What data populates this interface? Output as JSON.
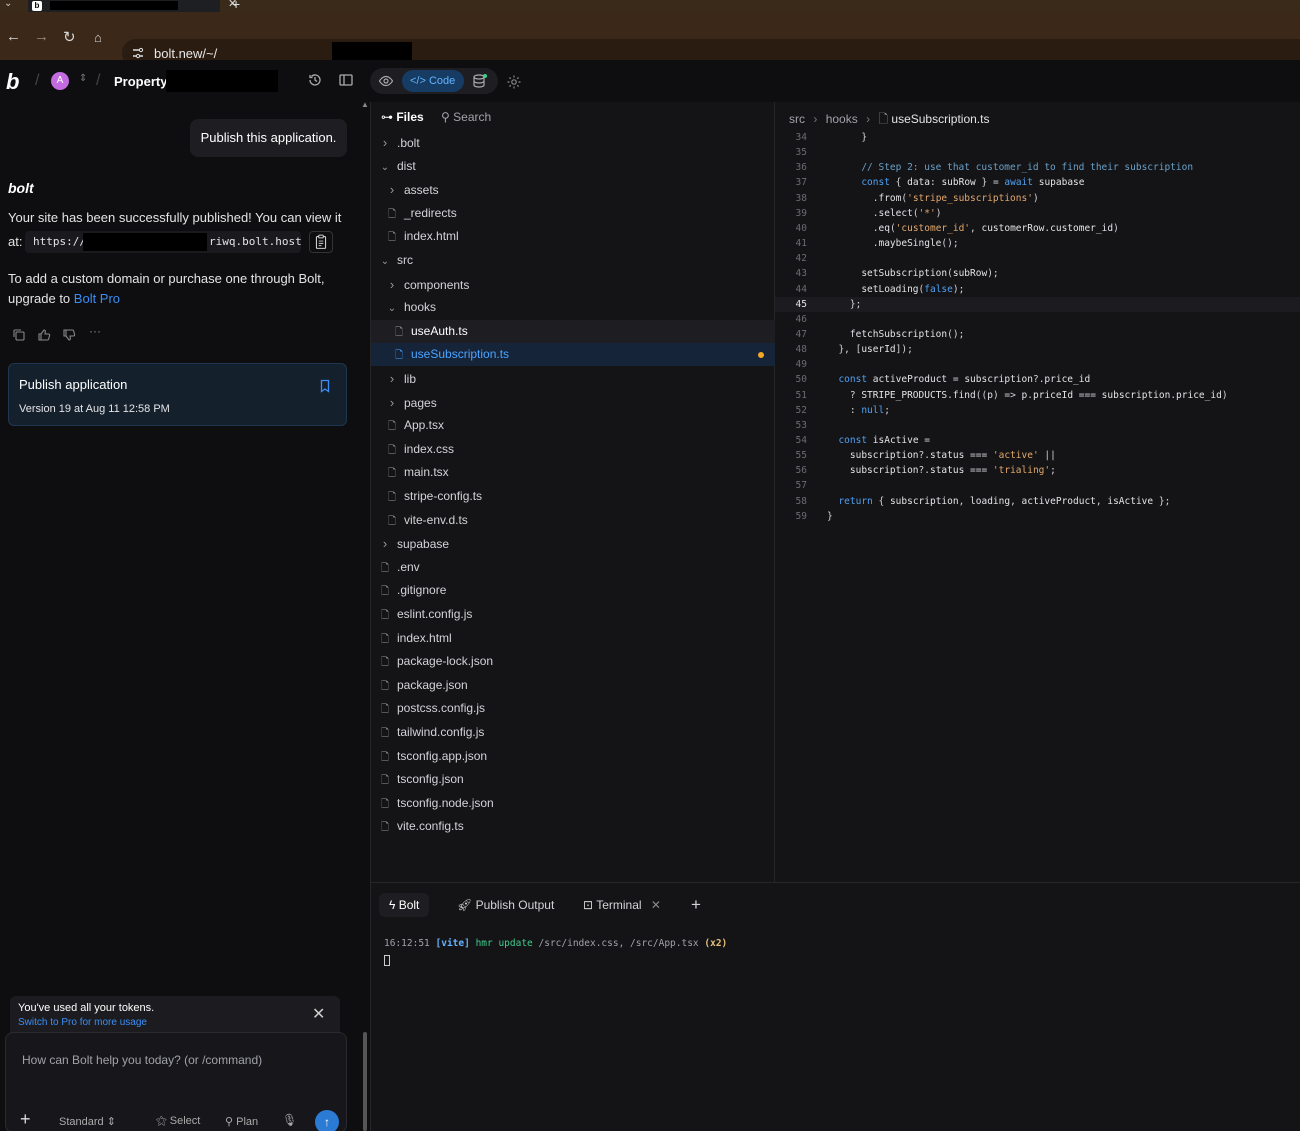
{
  "browser": {
    "tab_close": "✕",
    "new_tab": "+",
    "url": "bolt.new/~/"
  },
  "app": {
    "logo": "b",
    "avatar_initial": "A",
    "project_name": "Property",
    "view_code_label": "Code"
  },
  "chat": {
    "user_message": "Publish this application.",
    "assistant_name": "bolt",
    "published_text": "Your site has been successfully published! You can view it",
    "at_label": "at:",
    "url_prefix": "https://",
    "url_suffix": "riwq.bolt.host",
    "domain_text": "To add a custom domain or purchase one through Bolt,",
    "upgrade_text": "upgrade to",
    "upgrade_link": "Bolt Pro",
    "more": "···",
    "publish_card": {
      "title": "Publish application",
      "version": "Version 19 at Aug 11 12:58 PM"
    },
    "token_banner": {
      "line1": "You've used all your tokens.",
      "line2": "Switch to Pro for more usage"
    },
    "prompt": {
      "placeholder": "How can Bolt help you today? (or /command)",
      "mode": "Standard",
      "select": "Select",
      "plan": "Plan"
    }
  },
  "file_tree": {
    "files_label": "Files",
    "search_label": "Search",
    "items": [
      {
        "name": ".bolt",
        "type": "folder",
        "open": false,
        "depth": 0
      },
      {
        "name": "dist",
        "type": "folder",
        "open": true,
        "depth": 0
      },
      {
        "name": "assets",
        "type": "folder",
        "open": false,
        "depth": 1
      },
      {
        "name": "_redirects",
        "type": "file",
        "depth": 1
      },
      {
        "name": "index.html",
        "type": "file",
        "depth": 1
      },
      {
        "name": "src",
        "type": "folder",
        "open": true,
        "depth": 0
      },
      {
        "name": "components",
        "type": "folder",
        "open": false,
        "depth": 1
      },
      {
        "name": "hooks",
        "type": "folder",
        "open": true,
        "depth": 1
      },
      {
        "name": "useAuth.ts",
        "type": "file",
        "depth": 2,
        "state": "hover"
      },
      {
        "name": "useSubscription.ts",
        "type": "file",
        "depth": 2,
        "state": "selected",
        "modified": true
      },
      {
        "name": "lib",
        "type": "folder",
        "open": false,
        "depth": 1
      },
      {
        "name": "pages",
        "type": "folder",
        "open": false,
        "depth": 1
      },
      {
        "name": "App.tsx",
        "type": "file",
        "depth": 1
      },
      {
        "name": "index.css",
        "type": "file",
        "depth": 1
      },
      {
        "name": "main.tsx",
        "type": "file",
        "depth": 1
      },
      {
        "name": "stripe-config.ts",
        "type": "file",
        "depth": 1
      },
      {
        "name": "vite-env.d.ts",
        "type": "file",
        "depth": 1
      },
      {
        "name": "supabase",
        "type": "folder",
        "open": false,
        "depth": 0
      },
      {
        "name": ".env",
        "type": "file",
        "depth": 0
      },
      {
        "name": ".gitignore",
        "type": "file",
        "depth": 0
      },
      {
        "name": "eslint.config.js",
        "type": "file",
        "depth": 0
      },
      {
        "name": "index.html",
        "type": "file",
        "depth": 0
      },
      {
        "name": "package-lock.json",
        "type": "file",
        "depth": 0
      },
      {
        "name": "package.json",
        "type": "file",
        "depth": 0
      },
      {
        "name": "postcss.config.js",
        "type": "file",
        "depth": 0
      },
      {
        "name": "tailwind.config.js",
        "type": "file",
        "depth": 0
      },
      {
        "name": "tsconfig.app.json",
        "type": "file",
        "depth": 0
      },
      {
        "name": "tsconfig.json",
        "type": "file",
        "depth": 0
      },
      {
        "name": "tsconfig.node.json",
        "type": "file",
        "depth": 0
      },
      {
        "name": "vite.config.ts",
        "type": "file",
        "depth": 0
      }
    ]
  },
  "editor": {
    "breadcrumb": [
      "src",
      "hooks",
      "useSubscription.ts"
    ],
    "active_line": 45,
    "lines": [
      {
        "n": "34",
        "code": "      }"
      },
      {
        "n": "35",
        "code": ""
      },
      {
        "n": "36",
        "code": "      // Step 2: use that customer_id to find their subscription"
      },
      {
        "n": "37",
        "code": "      const { data: subRow } = await supabase"
      },
      {
        "n": "38",
        "code": "        .from('stripe_subscriptions')"
      },
      {
        "n": "39",
        "code": "        .select('*')"
      },
      {
        "n": "40",
        "code": "        .eq('customer_id', customerRow.customer_id)"
      },
      {
        "n": "41",
        "code": "        .maybeSingle();"
      },
      {
        "n": "42",
        "code": ""
      },
      {
        "n": "43",
        "code": "      setSubscription(subRow);"
      },
      {
        "n": "44",
        "code": "      setLoading(false);"
      },
      {
        "n": "45",
        "code": "    };"
      },
      {
        "n": "46",
        "code": ""
      },
      {
        "n": "47",
        "code": "    fetchSubscription();"
      },
      {
        "n": "48",
        "code": "  }, [userId]);"
      },
      {
        "n": "49",
        "code": ""
      },
      {
        "n": "50",
        "code": "  const activeProduct = subscription?.price_id"
      },
      {
        "n": "51",
        "code": "    ? STRIPE_PRODUCTS.find((p) => p.priceId === subscription.price_id)"
      },
      {
        "n": "52",
        "code": "    : null;"
      },
      {
        "n": "53",
        "code": ""
      },
      {
        "n": "54",
        "code": "  const isActive ="
      },
      {
        "n": "55",
        "code": "    subscription?.status === 'active' ||"
      },
      {
        "n": "56",
        "code": "    subscription?.status === 'trialing';"
      },
      {
        "n": "57",
        "code": ""
      },
      {
        "n": "58",
        "code": "  return { subscription, loading, activeProduct, isActive };"
      },
      {
        "n": "59",
        "code": "}"
      }
    ]
  },
  "bottom_panel": {
    "tabs": [
      "Bolt",
      "Publish Output",
      "Terminal"
    ],
    "active_tab": "Bolt",
    "add": "+",
    "terminal": {
      "time": "16:12:51",
      "tag": "[vite]",
      "event": "hmr update",
      "paths": "/src/index.css, /src/App.tsx",
      "count": "(x2)"
    }
  },
  "colors": {
    "accent": "#3b8ef5",
    "selected_file_bg": "#16243a",
    "modified_dot": "#f5a623",
    "browser_frame": "#3b2818"
  }
}
